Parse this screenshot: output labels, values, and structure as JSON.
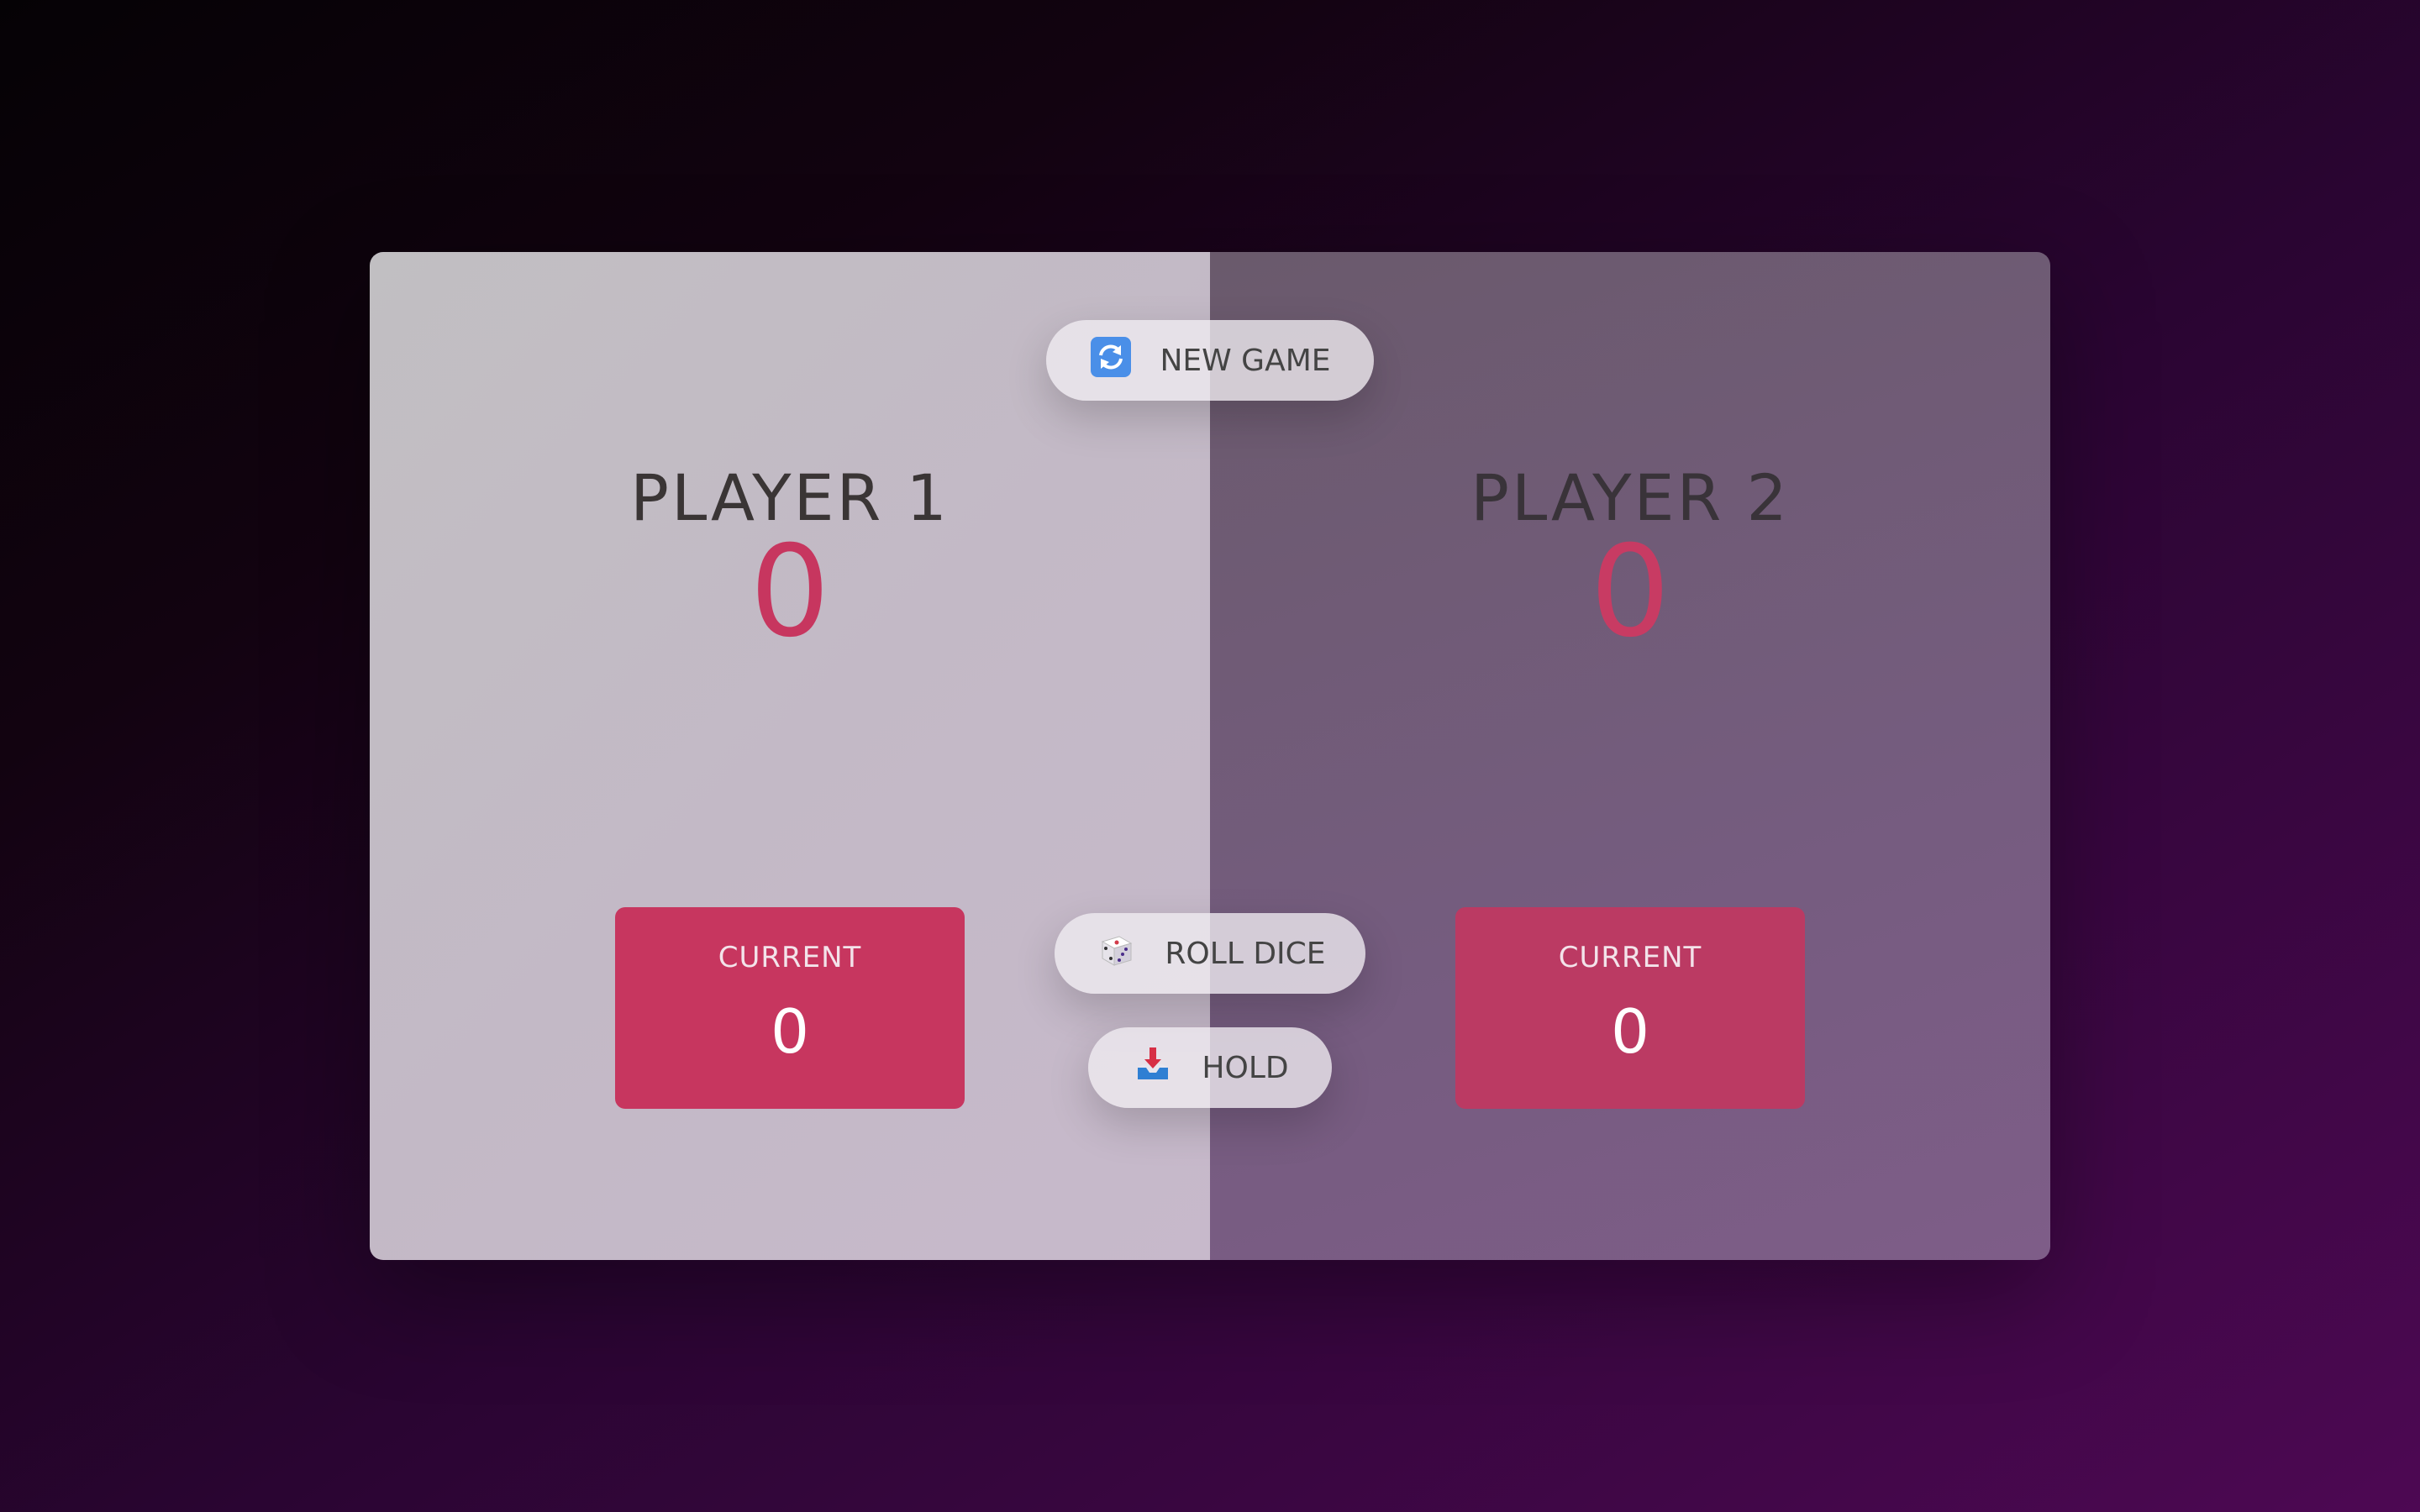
{
  "buttons": {
    "new_game": {
      "label": "NEW GAME",
      "icon": "refresh-icon"
    },
    "roll_dice": {
      "label": "ROLL DICE",
      "icon": "dice-icon"
    },
    "hold": {
      "label": "HOLD",
      "icon": "inbox-tray-icon"
    }
  },
  "players": [
    {
      "name": "PLAYER 1",
      "score": "0",
      "current_label": "CURRENT",
      "current_score": "0",
      "active": true
    },
    {
      "name": "PLAYER 2",
      "score": "0",
      "current_label": "CURRENT",
      "current_score": "0",
      "active": false
    }
  ],
  "colors": {
    "accent": "#c7365f",
    "active_panel": "#c3bcc6",
    "inactive_panel": "#755c7f"
  }
}
